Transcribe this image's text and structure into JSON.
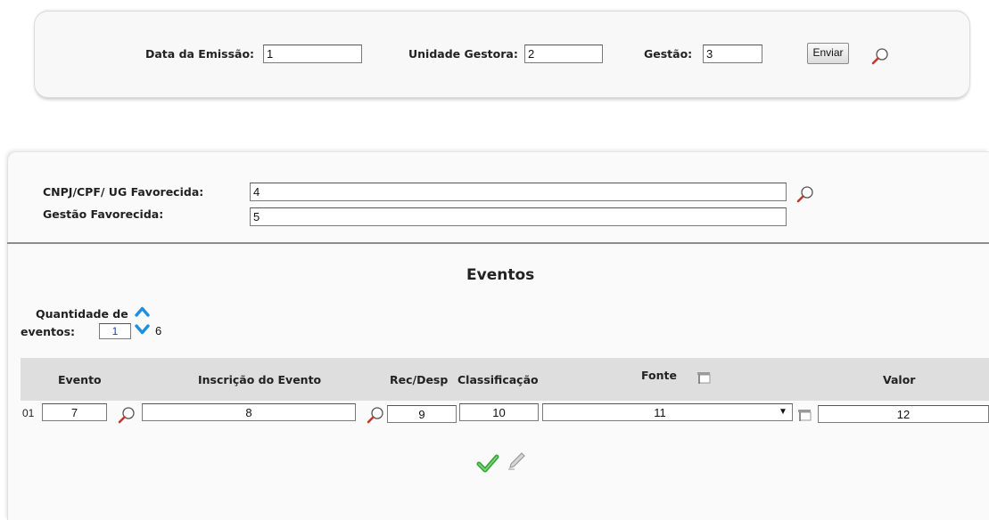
{
  "header_form": {
    "data_emissao_label": "Data da Emissão:",
    "data_emissao_value": "1",
    "unidade_gestora_label": "Unidade Gestora:",
    "unidade_gestora_value": "2",
    "gestao_label": "Gestão:",
    "gestao_value": "3",
    "send_button_label": "Enviar"
  },
  "favorecido": {
    "cnpj_label": "CNPJ/CPF/ UG Favorecida:",
    "cnpj_value": "4",
    "gestao_label": "Gestão Favorecida:",
    "gestao_value": "5"
  },
  "eventos": {
    "title": "Eventos",
    "quantidade_label_line1": "Quantidade de",
    "quantidade_label_line2": "eventos:",
    "quantidade_value": "1",
    "quantidade_annotation": "6",
    "columns": {
      "evento": "Evento",
      "inscricao": "Inscrição do Evento",
      "recdesp": "Rec/Desp",
      "classificacao": "Classificação",
      "fonte": "Fonte",
      "valor": "Valor"
    },
    "rows": [
      {
        "index": "01",
        "evento": "7",
        "inscricao": "8",
        "recdesp": "9",
        "classificacao": "10",
        "fonte": "11",
        "valor": "12"
      }
    ]
  },
  "colors": {
    "panel_bg": "#f8f8f8",
    "table_header_bg": "#dedede",
    "arrow_blue": "#1e8ee0",
    "confirm_green": "#3aa63a"
  },
  "icons": {
    "search": "magnifier-icon",
    "confirm": "checkmark-icon",
    "edit": "pencil-icon",
    "spinner_up": "chevron-up-icon",
    "spinner_down": "chevron-down-icon",
    "table_picker": "table-icon"
  }
}
